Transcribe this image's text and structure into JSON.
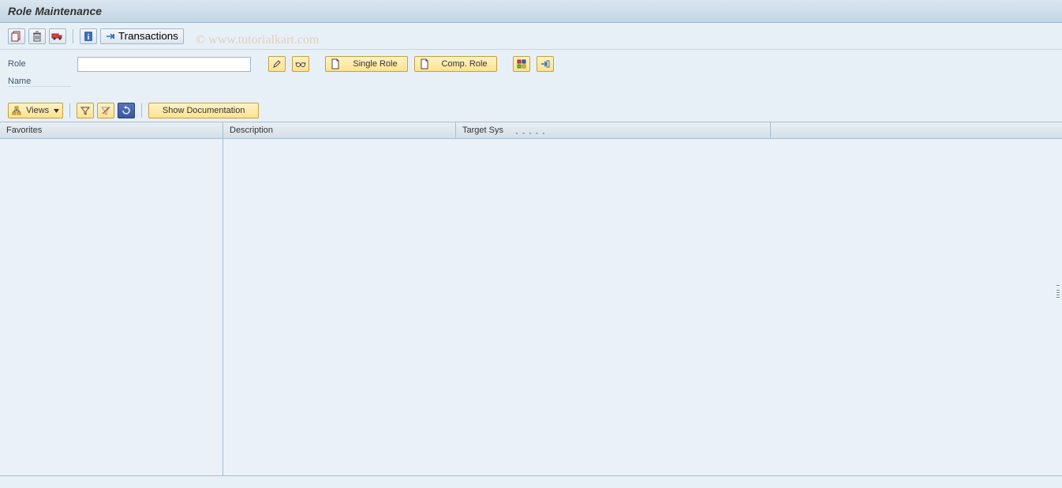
{
  "header": {
    "title": "Role Maintenance"
  },
  "toolbar": {
    "transactions_label": "Transactions"
  },
  "form": {
    "role_label": "Role",
    "role_value": "",
    "name_label": "Name",
    "name_value": "",
    "single_role_label": "Single Role",
    "comp_role_label": "Comp. Role"
  },
  "toolbar2": {
    "views_label": "Views",
    "show_doc_label": "Show Documentation"
  },
  "table": {
    "columns": {
      "favorites": "Favorites",
      "description": "Description",
      "target_sys": "Target Sys"
    }
  },
  "watermark": "© www.tutorialkart.com"
}
